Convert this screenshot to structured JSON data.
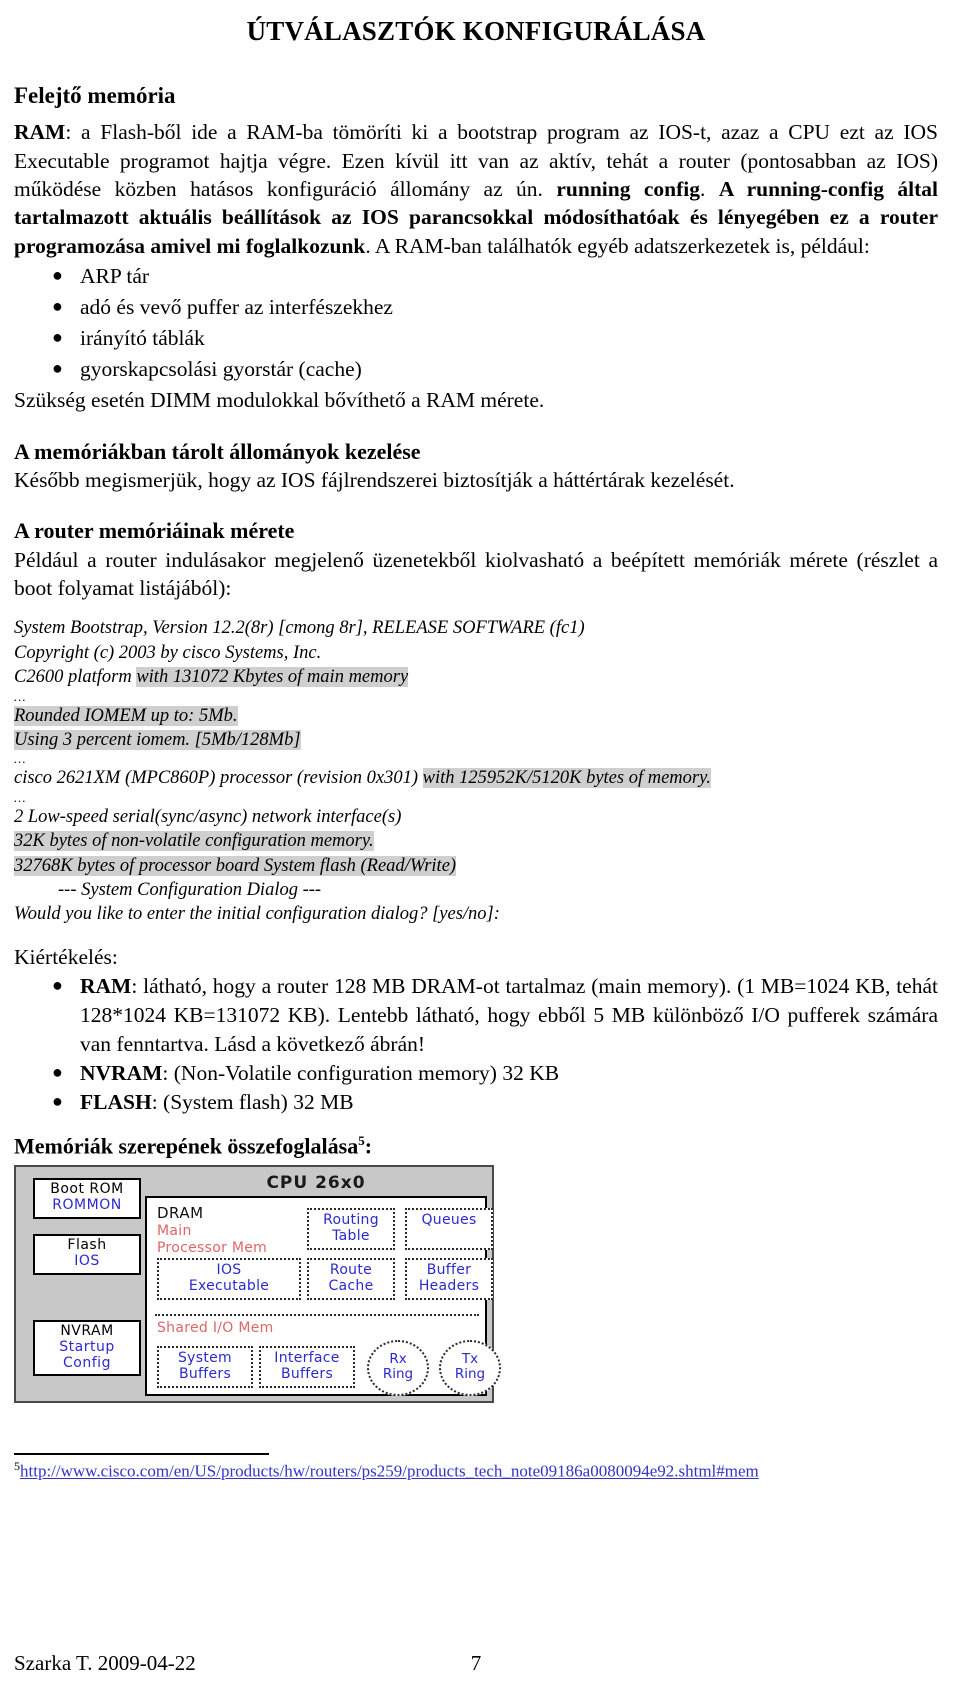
{
  "document": {
    "title": "ÚTVÁLASZTÓK KONFIGURÁLÁSA"
  },
  "sections": {
    "volatile_memory_heading": "Felejtő memória",
    "ram_paragraph": {
      "lead_bold": "RAM",
      "part1": ": a Flash-ből ide a RAM-ba tömöríti ki a bootstrap program az IOS-t, azaz a CPU ezt az IOS Executable programot hajtja végre. Ezen kívül itt van az aktív, tehát a router (pontosabban az IOS) működése közben hatásos konfiguráció állomány az ún. ",
      "bold1": "running config",
      "part2": ". ",
      "bold2": "A running-config által tartalmazott aktuális beállítások az IOS parancsokkal módosíthatóak és lényegében ez a router programozása amivel mi foglalkozunk",
      "part3": ". A RAM-ban találhatók egyéb adatszerkezetek is, például:"
    },
    "ram_bullets": [
      "ARP tár",
      "adó és vevő puffer az interfészekhez",
      "irányító táblák",
      "gyorskapcsolási gyorstár (cache)"
    ],
    "dimm_note": "Szükség esetén DIMM modulokkal bővíthető a RAM mérete.",
    "file_mgmt_heading": "A memóriákban tárolt állományok kezelése",
    "file_mgmt_text": "Később megismerjük, hogy az IOS fájlrendszerei biztosítják a háttértárak kezelését.",
    "size_heading": "A router memóriáinak mérete",
    "size_text": "Például a router indulásakor megjelenő üzenetekből kiolvasható a beépített memóriák mérete (részlet a boot folyamat listájából):"
  },
  "boot_listing": [
    {
      "type": "line",
      "text": "System Bootstrap, Version 12.2(8r) [cmong 8r], RELEASE SOFTWARE (fc1)",
      "highlight": false
    },
    {
      "type": "line",
      "text": "Copyright (c) 2003 by cisco Systems, Inc.",
      "highlight": false
    },
    {
      "type": "split",
      "plain": "C2600 platform ",
      "hl": "with 131072 Kbytes of main memory"
    },
    {
      "type": "ellipsis",
      "text": "..."
    },
    {
      "type": "line",
      "text": "Rounded IOMEM up to: 5Mb.",
      "highlight": true
    },
    {
      "type": "line",
      "text": "Using 3 percent iomem. [5Mb/128Mb]",
      "highlight": true
    },
    {
      "type": "ellipsis",
      "text": "..."
    },
    {
      "type": "split",
      "plain": "cisco 2621XM (MPC860P) processor (revision 0x301) ",
      "hl": "with 125952K/5120K bytes of memory."
    },
    {
      "type": "ellipsis",
      "text": "..."
    },
    {
      "type": "line",
      "text": "2 Low-speed serial(sync/async) network interface(s)",
      "highlight": false
    },
    {
      "type": "line",
      "text": "32K bytes of non-volatile configuration memory.",
      "highlight": true
    },
    {
      "type": "line",
      "text": "32768K bytes of processor board System flash (Read/Write)",
      "highlight": true
    },
    {
      "type": "indent",
      "text": "--- System Configuration Dialog ---",
      "highlight": false
    },
    {
      "type": "line",
      "text": "Would you like to enter the initial configuration dialog? [yes/no]:",
      "highlight": false
    }
  ],
  "evaluation": {
    "label": "Kiértékelés:",
    "items": [
      {
        "term": "RAM",
        "text": ": látható, hogy a router 128 MB DRAM-ot tartalmaz (main memory). (1 MB=1024 KB, tehát 128*1024 KB=131072 KB). Lentebb látható, hogy ebből 5 MB különböző I/O pufferek számára van fenntartva. Lásd a következő ábrán!"
      },
      {
        "term": "NVRAM",
        "text": ": (Non-Volatile configuration memory) 32 KB"
      },
      {
        "term": "FLASH",
        "text": ": (System flash) 32 MB"
      }
    ]
  },
  "figure": {
    "heading_text": "Memóriák szerepének összefoglalása",
    "heading_sup": "5",
    "heading_tail": ":",
    "diagram": {
      "cpu_label": "CPU 26x0",
      "left_boxes": [
        {
          "name": "boot-rom",
          "line1": "Boot ROM",
          "line2": "ROMMON"
        },
        {
          "name": "flash",
          "line1": "Flash",
          "line2": "IOS"
        },
        {
          "name": "nvram",
          "line1": "NVRAM",
          "line2": "Startup",
          "line3": "Config"
        }
      ],
      "dram_label": "DRAM",
      "main_proc_label_1": "Main",
      "main_proc_label_2": "Processor Mem",
      "dram_boxes": [
        {
          "name": "routing-table",
          "line1": "Routing",
          "line2": "Table"
        },
        {
          "name": "queues",
          "line1": "Queues",
          "line2": ""
        },
        {
          "name": "ios-executable",
          "line1": "IOS",
          "line2": "Executable"
        },
        {
          "name": "route-cache",
          "line1": "Route",
          "line2": "Cache"
        },
        {
          "name": "buffer-headers",
          "line1": "Buffer",
          "line2": "Headers"
        }
      ],
      "shared_io_label": "Shared I/O Mem",
      "io_boxes": [
        {
          "name": "system-buffers",
          "line1": "System",
          "line2": "Buffers"
        },
        {
          "name": "interface-buffers",
          "line1": "Interface",
          "line2": "Buffers"
        }
      ],
      "rings": [
        {
          "name": "rx-ring",
          "line1": "Rx",
          "line2": "Ring"
        },
        {
          "name": "tx-ring",
          "line1": "Tx",
          "line2": "Ring"
        }
      ],
      "colors": {
        "frame_bg": "#c8c8c8",
        "box_text_blue": "#2a2ad0",
        "label_red": "#e06666"
      }
    }
  },
  "footnote": {
    "marker": "5",
    "url": "http://www.cisco.com/en/US/products/hw/routers/ps259/products_tech_note09186a0080094e92.shtml#mem"
  },
  "page_footer": {
    "author_date": "Szarka T.  2009-04-22",
    "page_number": "7"
  }
}
